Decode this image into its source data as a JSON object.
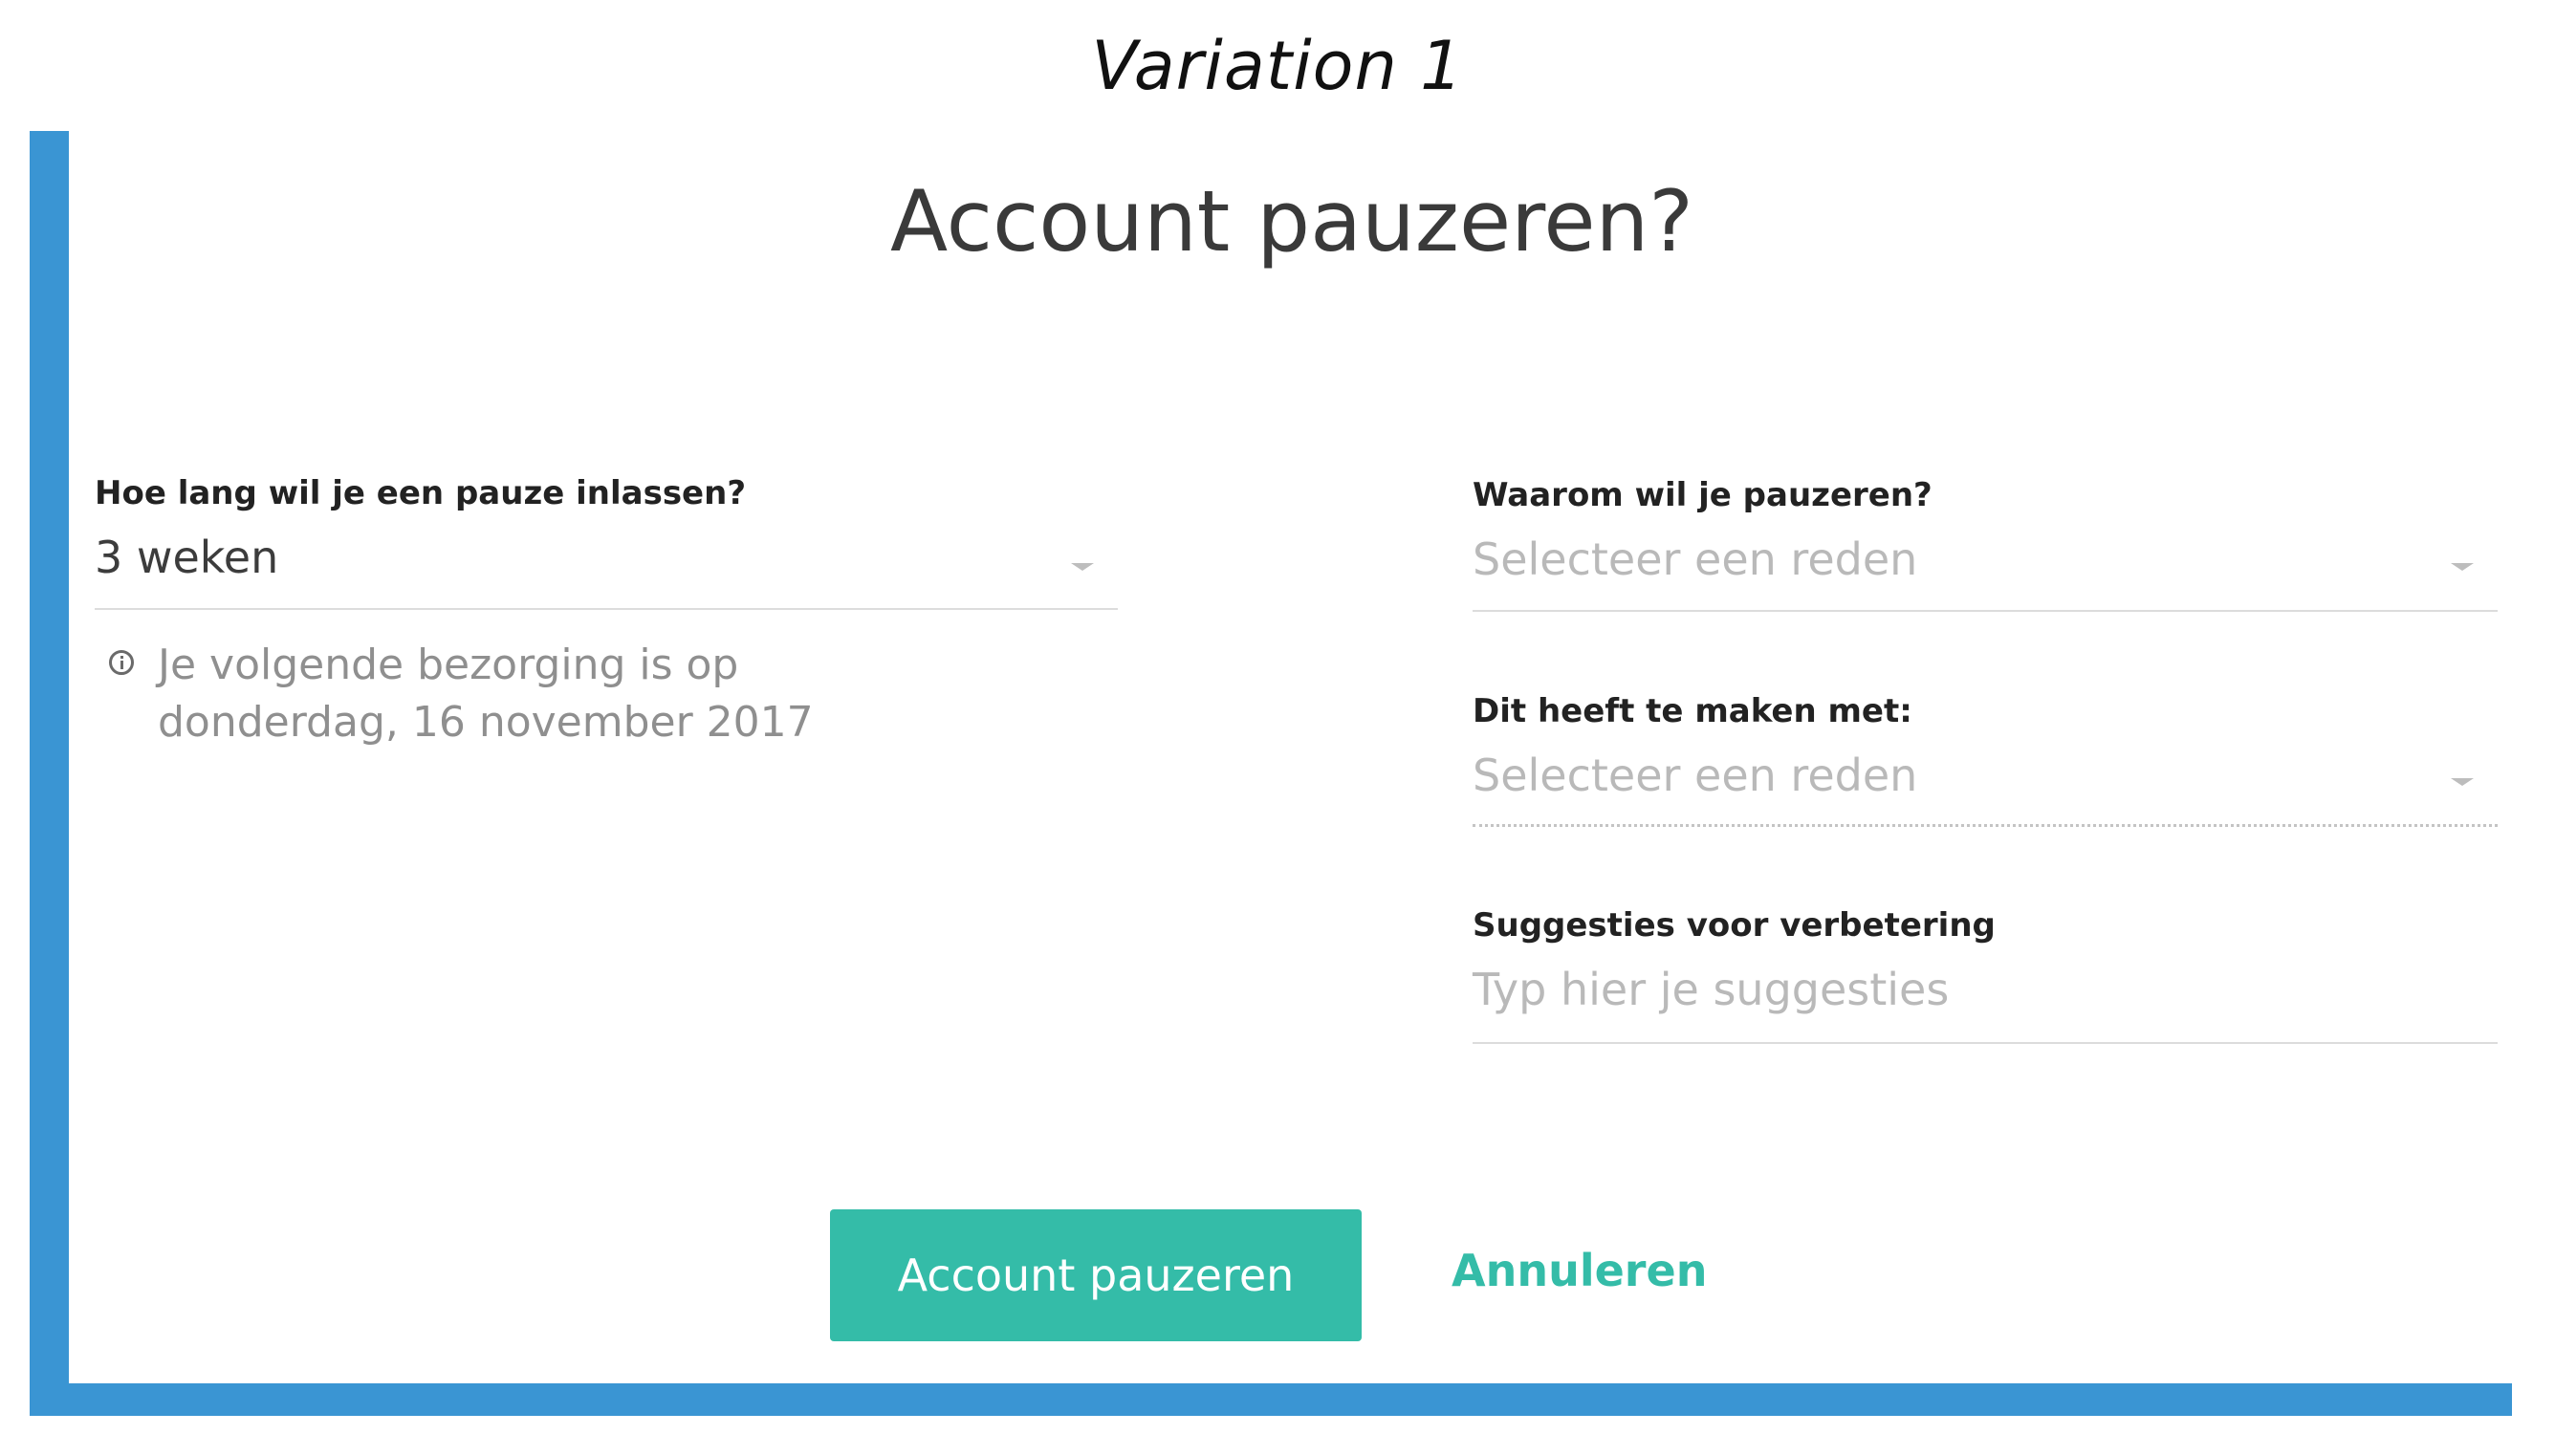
{
  "caption": "Variation 1",
  "dialog": {
    "title": "Account pauzeren?"
  },
  "duration": {
    "label": "Hoe lang wil je een pauze inlassen?",
    "value": "3 weken"
  },
  "next_delivery": {
    "line1": "Je volgende bezorging is op",
    "line2": "donderdag, 16 november 2017"
  },
  "reason": {
    "label": "Waarom wil je pauzeren?",
    "placeholder": "Selecteer een reden"
  },
  "related": {
    "label": "Dit heeft te maken met:",
    "placeholder": "Selecteer een reden"
  },
  "suggestions": {
    "label": "Suggesties voor verbetering",
    "placeholder": "Typ hier je suggesties"
  },
  "actions": {
    "primary_label": "Account pauzeren",
    "cancel_label": "Annuleren"
  },
  "colors": {
    "frame": "#3a95d3",
    "accent": "#34bca8"
  }
}
